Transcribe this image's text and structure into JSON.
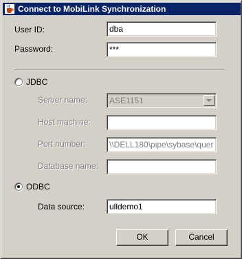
{
  "window": {
    "title": "Connect to MobiLink Synchronization",
    "icon": "java-cup-icon"
  },
  "login": {
    "user_id_label": "User ID:",
    "user_id_value": "dba",
    "password_label": "Password:",
    "password_value": "***"
  },
  "jdbc": {
    "label": "JDBC",
    "selected": false,
    "server_name_label": "Server name:",
    "server_name_value": "ASE1151",
    "host_machine_label": "Host machine:",
    "host_machine_value": "",
    "port_number_label": "Port number:",
    "port_number_value": "\\\\DELL180\\pipe\\sybase\\quer",
    "database_name_label": "Database name:",
    "database_name_value": ""
  },
  "odbc": {
    "label": "ODBC",
    "selected": true,
    "data_source_label": "Data source:",
    "data_source_value": "ulldemo1"
  },
  "buttons": {
    "ok": "OK",
    "cancel": "Cancel"
  },
  "colors": {
    "titlebar": "#0a246a",
    "face": "#d4d0c8",
    "disabled_text": "#808080"
  }
}
